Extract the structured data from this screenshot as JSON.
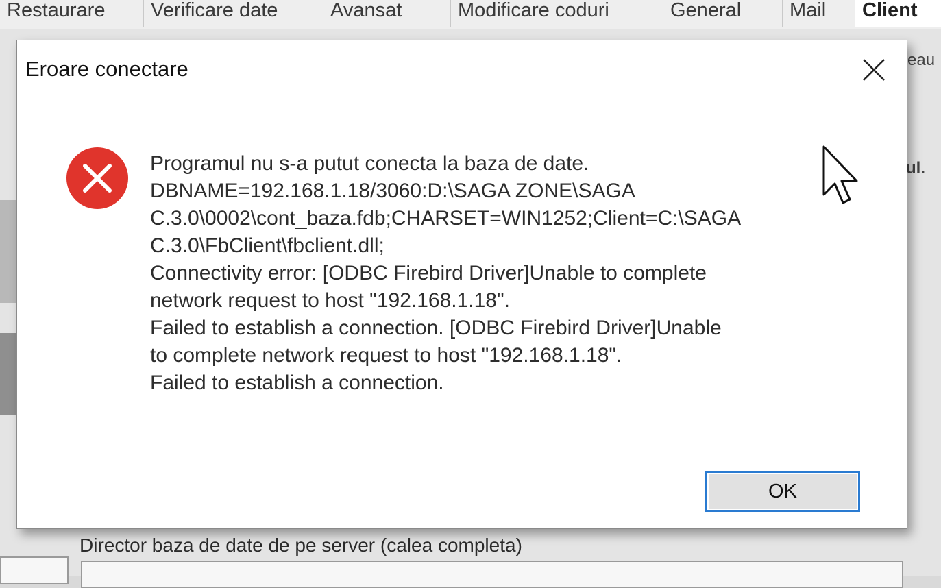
{
  "background_app": {
    "tabs": [
      {
        "label": "Restaurare"
      },
      {
        "label": "Verificare date"
      },
      {
        "label": "Avansat"
      },
      {
        "label": "Modificare coduri"
      },
      {
        "label": "General"
      },
      {
        "label": "Mail"
      },
      {
        "label": "Client"
      }
    ],
    "side_fragments": {
      "right_top": "eau",
      "right_mid": "ul."
    },
    "db_dir_label": "Director baza de date de pe server (calea completa)",
    "db_dir_value": ""
  },
  "dialog": {
    "title": "Eroare conectare",
    "icon": "error-icon",
    "message_lines": [
      "Programul nu s-a putut conecta la baza de date.",
      "DBNAME=192.168.1.18/3060:D:\\SAGA ZONE\\SAGA",
      "C.3.0\\0002\\cont_baza.fdb;CHARSET=WIN1252;Client=C:\\SAGA",
      "C.3.0\\FbClient\\fbclient.dll;",
      "Connectivity error: [ODBC Firebird Driver]Unable to complete",
      "network request to host \"192.168.1.18\".",
      "Failed to establish a connection. [ODBC Firebird Driver]Unable",
      "to complete network request to host \"192.168.1.18\".",
      "Failed to establish a connection."
    ],
    "ok_label": "OK",
    "colors": {
      "error_red": "#e0342c",
      "focus_blue": "#2a7bd1"
    }
  }
}
